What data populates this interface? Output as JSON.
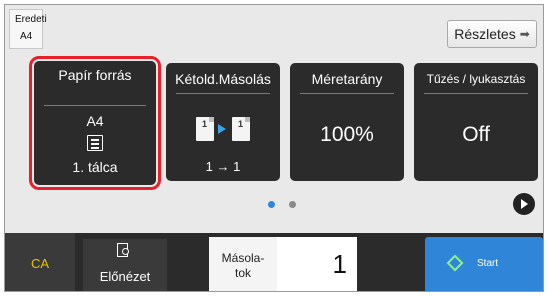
{
  "original": {
    "title": "Eredeti",
    "size": "A4"
  },
  "details_button": {
    "label": "Részletes"
  },
  "tiles": {
    "paper_source": {
      "title": "Papír forrás",
      "size": "A4",
      "tray": "1. tálca"
    },
    "duplex": {
      "title": "Kétold.Másolás",
      "mode": "1 → 1"
    },
    "ratio": {
      "title": "Méretarány",
      "value": "100%"
    },
    "staple": {
      "title": "Tűzés / lyukasztás",
      "value": "Off"
    }
  },
  "pagination": {
    "current_page": 1,
    "page_count": 2
  },
  "bottom": {
    "ca_label": "CA",
    "preview_label": "Előnézet",
    "copies_label": "Másola-\ntok",
    "copies_value": "1",
    "start_label": "Start"
  },
  "colors": {
    "accent": "#2f86d8",
    "highlight": "#e8202a",
    "tile_bg": "#2b2b2b",
    "ca_text": "#e8c400"
  },
  "icons": [
    "paper-tray-icon",
    "duplex-icon",
    "preview-icon",
    "start-icon",
    "next-page-icon"
  ]
}
